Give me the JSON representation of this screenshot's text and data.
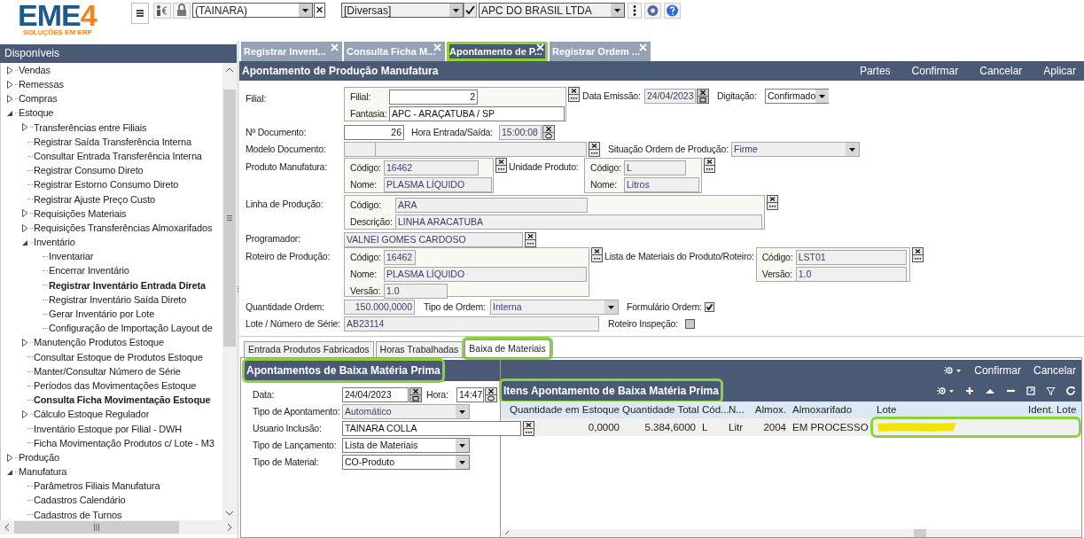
{
  "header": {
    "logo": {
      "main": "EME",
      "accent": "4",
      "tagline": "SOLUÇÕES EM ERP"
    },
    "user": "(TAINARA)",
    "category": "[Diversas]",
    "company": "APC DO BRASIL LTDA"
  },
  "sidebar": {
    "title": "Disponíveis",
    "tree": [
      {
        "label": "Vendas",
        "kind": "folder",
        "expanded": false,
        "bold": false
      },
      {
        "label": "Remessas",
        "kind": "folder",
        "expanded": false,
        "bold": false
      },
      {
        "label": "Compras",
        "kind": "folder",
        "expanded": false,
        "bold": false
      },
      {
        "label": "Estoque",
        "kind": "folder",
        "expanded": true,
        "bold": false,
        "children": [
          {
            "label": "Transferências entre Filiais",
            "kind": "folder",
            "expanded": false,
            "bold": false
          },
          {
            "label": "Registrar Saída Transferência Interna",
            "kind": "leaf",
            "bold": false
          },
          {
            "label": "Consultar Entrada Transferência Interna",
            "kind": "leaf",
            "bold": false
          },
          {
            "label": "Registrar Consumo Direto",
            "kind": "leaf",
            "bold": false
          },
          {
            "label": "Registrar Estorno Consumo Direto",
            "kind": "leaf",
            "bold": false
          },
          {
            "label": "Registrar Ajuste Preço Custo",
            "kind": "leaf",
            "bold": false
          },
          {
            "label": "Requisições Materiais",
            "kind": "folder",
            "expanded": false,
            "bold": false
          },
          {
            "label": "Requisições Transferências Almoxarifados",
            "kind": "folder",
            "expanded": false,
            "bold": false
          },
          {
            "label": "Inventário",
            "kind": "folder",
            "expanded": true,
            "bold": false,
            "children": [
              {
                "label": "Inventariar",
                "kind": "leaf",
                "bold": false
              },
              {
                "label": "Encerrar Inventário",
                "kind": "leaf",
                "bold": false
              },
              {
                "label": "Registrar Inventário Entrada Direta",
                "kind": "leaf",
                "bold": true
              },
              {
                "label": "Registrar Inventário Saída Direto",
                "kind": "leaf",
                "bold": false
              },
              {
                "label": "Gerar Inventário por Lote",
                "kind": "leaf",
                "bold": false
              },
              {
                "label": "Configuração de Importação Layout de",
                "kind": "leaf",
                "bold": false
              }
            ]
          },
          {
            "label": "Manutenção Produtos Estoque",
            "kind": "folder",
            "expanded": false,
            "bold": false
          },
          {
            "label": "Consultar Estoque de Produtos Estoque",
            "kind": "leaf",
            "bold": false
          },
          {
            "label": "Manter/Consultar Número de Série",
            "kind": "leaf",
            "bold": false
          },
          {
            "label": "Períodos das Movimentações Estoque",
            "kind": "leaf",
            "bold": false
          },
          {
            "label": "Consulta Ficha Movimentação Estoque",
            "kind": "leaf",
            "bold": true
          },
          {
            "label": "Cálculo Estoque Regulador",
            "kind": "folder",
            "expanded": false,
            "bold": false
          },
          {
            "label": "Inventário Estoque por Filial - DWH",
            "kind": "leaf",
            "bold": false
          },
          {
            "label": "Ficha Movimentação Produtos c/ Lote - M3",
            "kind": "leaf",
            "bold": false
          }
        ]
      },
      {
        "label": "Produção",
        "kind": "folder",
        "expanded": false,
        "bold": false
      },
      {
        "label": "Manufatura",
        "kind": "folder",
        "expanded": true,
        "bold": false,
        "children": [
          {
            "label": "Parâmetros Filiais Manufatura",
            "kind": "leaf",
            "bold": false
          },
          {
            "label": "Cadastros Calendário",
            "kind": "leaf",
            "bold": false
          },
          {
            "label": "Cadastros de Turnos",
            "kind": "leaf",
            "bold": false
          }
        ]
      }
    ]
  },
  "tabs": [
    {
      "label": "Registrar Invent...",
      "selected": false,
      "highlighted": false
    },
    {
      "label": "Consulta Ficha M...",
      "selected": false,
      "highlighted": false
    },
    {
      "label": "Apontamento de P...",
      "selected": true,
      "highlighted": true
    },
    {
      "label": "Registrar Ordem ...",
      "selected": false,
      "highlighted": false
    }
  ],
  "toolbar": {
    "title": "Apontamento de Produção Manufatura",
    "actions": [
      "Partes",
      "Confirmar",
      "Cancelar",
      "Aplicar"
    ]
  },
  "form": {
    "filial": {
      "label": "Filial:",
      "code_label": "Filial:",
      "code": "2",
      "fantasia_label": "Fantasia:",
      "fantasia": "APC - ARAÇATUBA / SP"
    },
    "data_emissao": {
      "label": "Data Emissão:",
      "value": "24/04/2023"
    },
    "digitacao": {
      "label": "Digitação:",
      "value": "Confirmado"
    },
    "documento": {
      "label": "Nº Documento:",
      "value": "26"
    },
    "hora": {
      "label": "Hora Entrada/Saída:",
      "value": "15:00:08"
    },
    "modelo": {
      "label": "Modelo Documento:"
    },
    "situacao": {
      "label": "Situação Ordem de Produção:",
      "value": "Firme"
    },
    "produto": {
      "label": "Produto Manufatura:",
      "codigo_label": "Código:",
      "codigo": "16462",
      "nome_label": "Nome:",
      "nome": "PLASMA LÍQUIDO"
    },
    "unidade": {
      "label": "Unidade Produto:",
      "codigo_label": "Código:",
      "codigo": "L",
      "nome_label": "Nome:",
      "nome": "Litros"
    },
    "linha": {
      "label": "Linha de Produção:",
      "codigo_label": "Código:",
      "codigo": "ARA",
      "descricao_label": "Descrição:",
      "descricao": "LINHA ARACATUBA"
    },
    "programador": {
      "label": "Programador:",
      "value": "VALNEI GOMES CARDOSO"
    },
    "roteiro": {
      "label": "Roteiro de Produção:",
      "codigo_label": "Código:",
      "codigo": "16462",
      "nome_label": "Nome:",
      "nome": "PLASMA LÍQUIDO",
      "versao_label": "Versão:",
      "versao": "1.0"
    },
    "lista": {
      "label": "Lista de Materiais do Produto/Roteiro:",
      "codigo_label": "Código:",
      "codigo": "LST01",
      "versao_label": "Versão:",
      "versao": "1.0"
    },
    "quantidade": {
      "label": "Quantidade Ordem:",
      "value": "150.000,0000"
    },
    "tipo_ordem": {
      "label": "Tipo de Ordem:",
      "value": "Interna"
    },
    "formulario": {
      "label": "Formulário Ordem:",
      "checked": true
    },
    "lote": {
      "label": "Lote / Número de Série:",
      "value": "AB23114"
    },
    "inspecao": {
      "label": "Roteiro Inspeção:",
      "checked": false
    }
  },
  "subtabs": [
    {
      "label": "Entrada Produtos Fabricados",
      "selected": false,
      "highlighted": false
    },
    {
      "label": "Horas Trabalhadas",
      "selected": false,
      "highlighted": false
    },
    {
      "label": "Baixa de Materiais",
      "selected": true,
      "highlighted": true
    }
  ],
  "baixa": {
    "title": "Apontamentos de Baixa Matéria Prima",
    "title_highlighted": true,
    "data": {
      "label": "Data:",
      "value": "24/04/2023"
    },
    "hora": {
      "label": "Hora:",
      "value": "14:47"
    },
    "fields": [
      {
        "label": "Tipo de Apontamento:",
        "value": "Automático",
        "kind": "readonly_select"
      },
      {
        "label": "Usuario Inclusão:",
        "value": "TAINARA COLLA",
        "kind": "lookup"
      },
      {
        "label": "Tipo de Lançamento:",
        "value": "Lista de Materiais",
        "kind": "select"
      },
      {
        "label": "Tipo de Material:",
        "value": "CO-Produto",
        "kind": "select"
      }
    ]
  },
  "itens": {
    "actions": [
      "Confirmar",
      "Cancelar"
    ],
    "title": "Itens Apontamento de Baixa Matéria Prima",
    "title_highlighted": true,
    "columns": [
      "Quantidade em Estoque",
      "Quantidade Total",
      "Cód...",
      "N...",
      "Almox.",
      "Almoxarifado",
      "Lote",
      "Ident. Lote"
    ],
    "rows": [
      {
        "cells": [
          "0,0000",
          "5.384,6000",
          "L",
          "Litr",
          "2004",
          "EM PROCESSO"
        ],
        "redacted": true,
        "lote_highlighted": true
      }
    ]
  }
}
